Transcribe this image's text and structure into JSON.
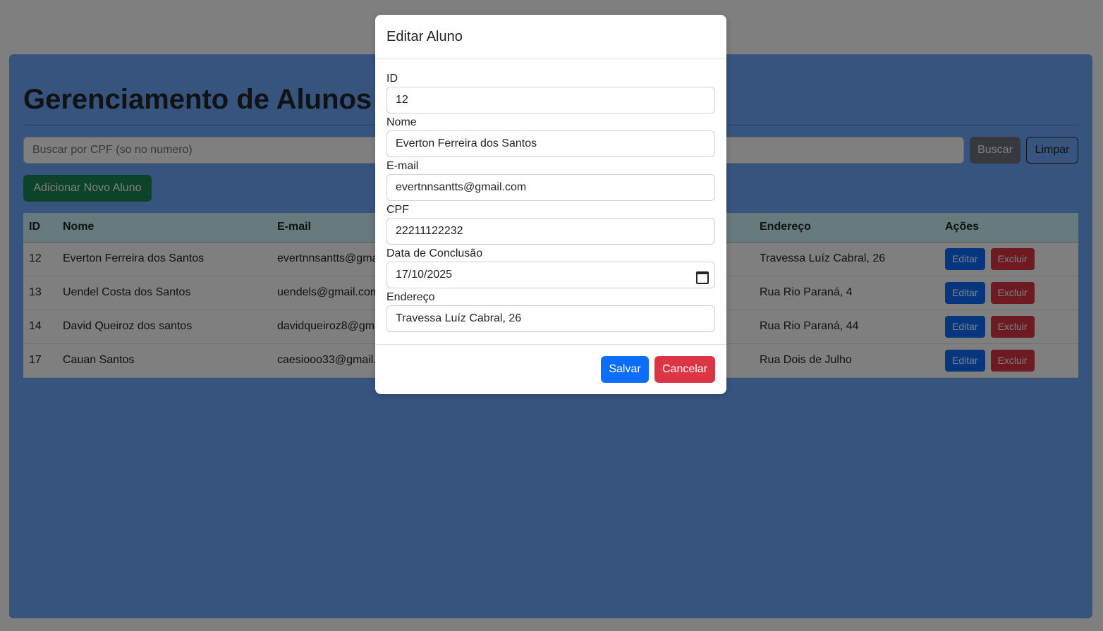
{
  "page": {
    "title": "Gerenciamento de Alunos - ",
    "search_placeholder": "Buscar por CPF (so no numero)",
    "search_button": "Buscar",
    "clear_button": "Limpar",
    "add_button": "Adicionar Novo Aluno"
  },
  "table": {
    "headers": {
      "id": "ID",
      "nome": "Nome",
      "email": "E-mail",
      "endereco": "Endereço",
      "acoes": "Ações"
    },
    "rows": [
      {
        "id": "12",
        "nome": "Everton Ferreira dos Santos",
        "email": "evertnnsantts@gmail.com",
        "endereco": "Travessa Luíz Cabral, 26",
        "edit": "Editar",
        "delete": "Excluir"
      },
      {
        "id": "13",
        "nome": "Uendel Costa dos Santos",
        "email": "uendels@gmail.com",
        "endereco": "Rua Rio Paraná, 4",
        "edit": "Editar",
        "delete": "Excluir"
      },
      {
        "id": "14",
        "nome": "David Queiroz dos santos",
        "email": "davidqueiroz8@gmail.com",
        "endereco": "Rua Rio Paraná, 44",
        "edit": "Editar",
        "delete": "Excluir"
      },
      {
        "id": "17",
        "nome": "Cauan Santos",
        "email": "caesiooo33@gmail.com",
        "endereco": "Rua Dois de Julho",
        "edit": "Editar",
        "delete": "Excluir"
      }
    ]
  },
  "modal": {
    "title": "Editar Aluno",
    "fields": {
      "id": {
        "label": "ID",
        "value": "12"
      },
      "nome": {
        "label": "Nome",
        "value": "Everton Ferreira dos Santos"
      },
      "email": {
        "label": "E-mail",
        "value": "evertnnsantts@gmail.com"
      },
      "cpf": {
        "label": "CPF",
        "value": "22211122232"
      },
      "data": {
        "label": "Data de Conclusão",
        "value": "17/10/2025"
      },
      "endereco": {
        "label": "Endereço",
        "value": "Travessa Luíz Cabral, 26"
      }
    },
    "save_button": "Salvar",
    "cancel_button": "Cancelar"
  },
  "colors": {
    "page_card": "#6ea8fe",
    "primary": "#0d6efd",
    "danger": "#dc3545",
    "success": "#198754",
    "secondary": "#6c757d",
    "table_header": "#cff4fc"
  }
}
